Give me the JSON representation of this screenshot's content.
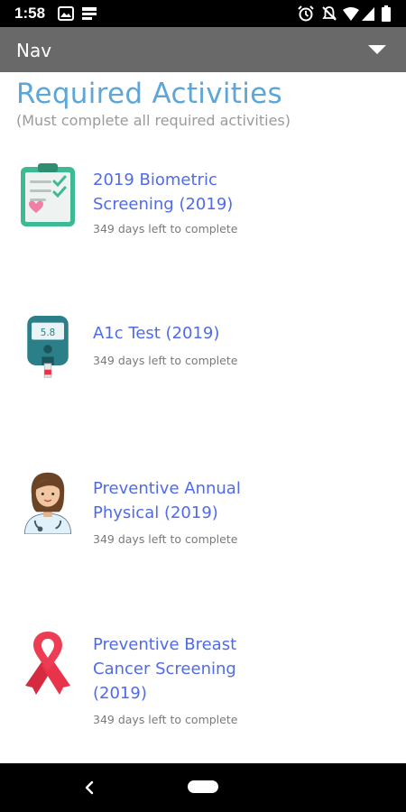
{
  "status_bar": {
    "time": "1:58",
    "left_icons": [
      "image-icon",
      "notification-icon"
    ],
    "right_icons": [
      "alarm-icon",
      "mute-icon",
      "wifi-icon",
      "signal-icon",
      "battery-icon"
    ]
  },
  "nav": {
    "label": "Nav",
    "dropdown_icon": "caret-down-icon"
  },
  "header": {
    "title": "Required Activities",
    "subtitle": "(Must complete all required activities)"
  },
  "activities": [
    {
      "title": "2019 Biometric Screening (2019)",
      "subtitle": "349 days left to complete",
      "icon": "clipboard-heart-icon"
    },
    {
      "title": "A1c Test (2019)",
      "subtitle": "349 days left to complete",
      "icon": "glucose-meter-icon",
      "icon_reading": "5.8"
    },
    {
      "title": "Preventive Annual Physical (2019)",
      "subtitle": "349 days left to complete",
      "icon": "doctor-icon"
    },
    {
      "title": "Preventive Breast Cancer Screening (2019)",
      "subtitle": "349 days left to complete",
      "icon": "pink-ribbon-icon"
    }
  ],
  "system_nav": {
    "back_icon": "back-icon",
    "home_icon": "home-pill-icon"
  },
  "colors": {
    "title_blue": "#5da6d6",
    "link_blue": "#4f6be8",
    "nav_gray": "#696969",
    "ribbon_red": "#e8334a",
    "clipboard_green": "#3dba93"
  }
}
